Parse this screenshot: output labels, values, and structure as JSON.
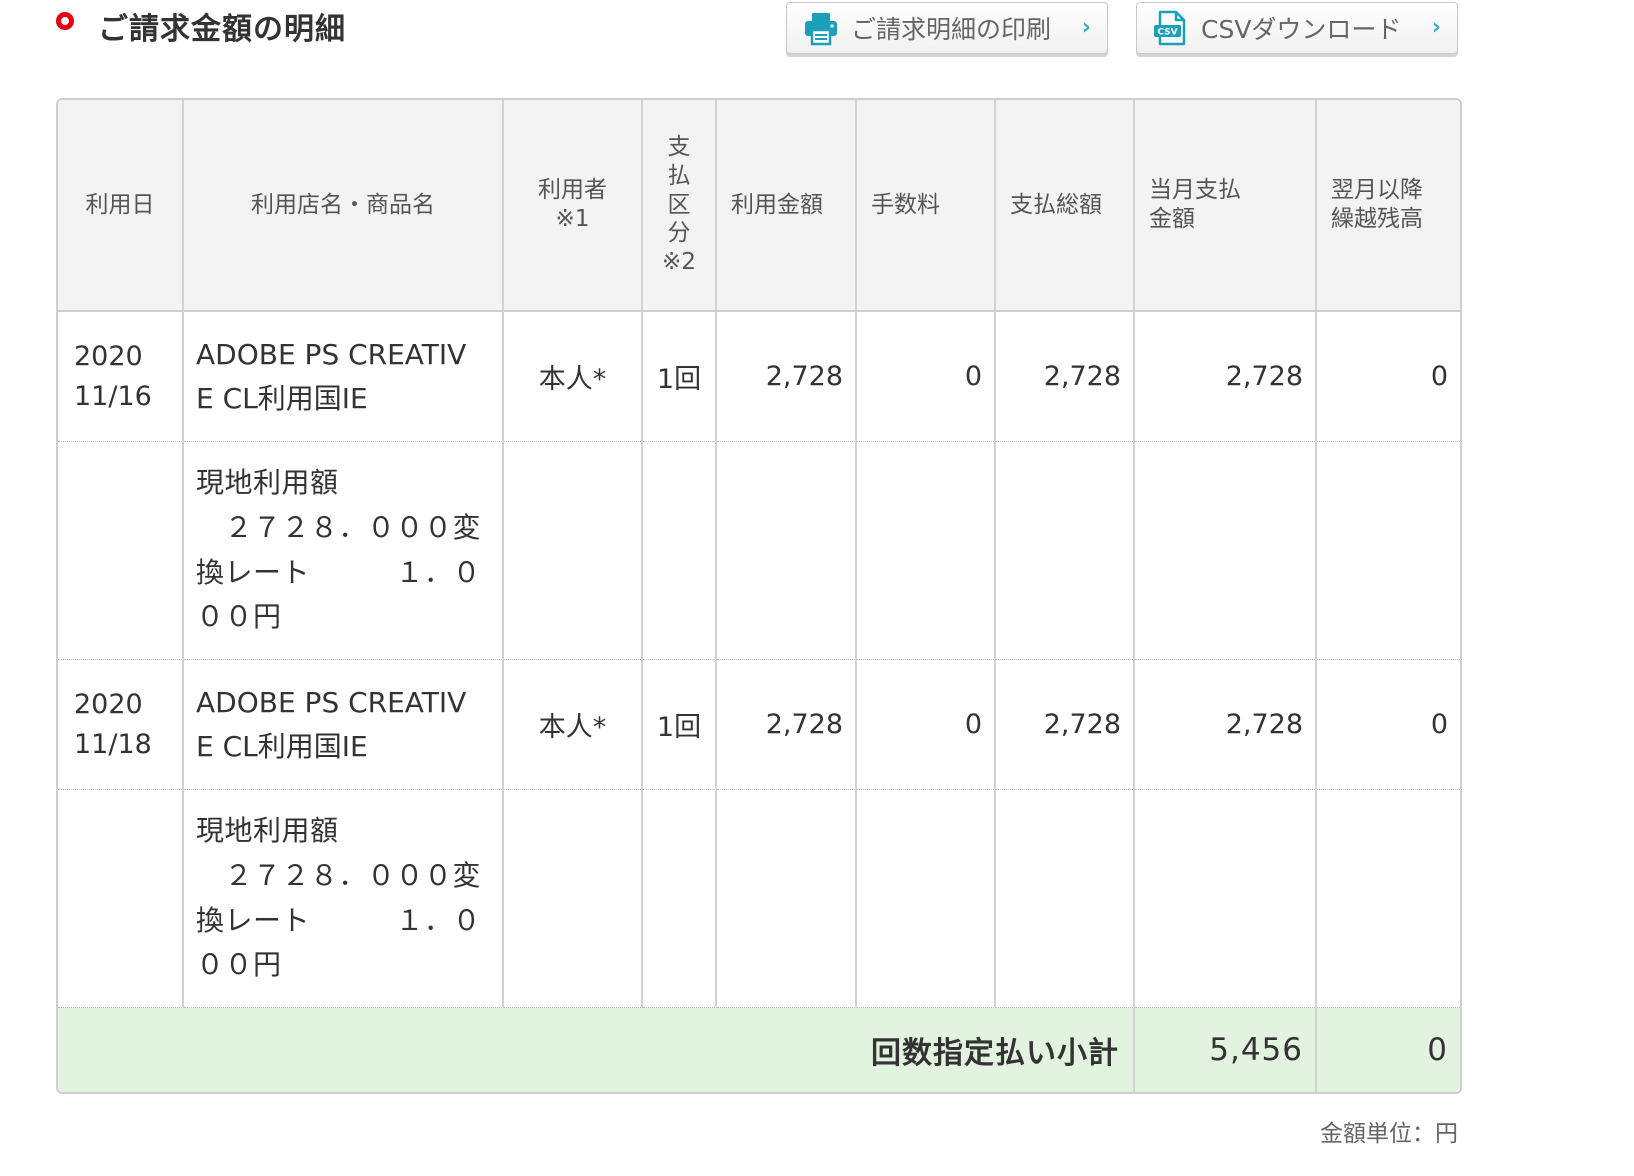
{
  "header": {
    "title": "ご請求金額の明細",
    "buttons": {
      "print_label": "ご請求明細の印刷",
      "csv_label": "CSVダウンロード",
      "chevron": "›",
      "print_icon": "printer-icon",
      "csv_icon": "csv-file-icon"
    }
  },
  "table": {
    "columns": {
      "date": "利用日",
      "shop": "利用店名・商品名",
      "user_line1": "利用者",
      "user_line2": "※1",
      "pay_type_chars": [
        "支",
        "払",
        "区",
        "分",
        "※2"
      ],
      "amount": "利用金額",
      "fee": "手数料",
      "total": "支払総額",
      "current_line1": "当月支払",
      "current_line2": "金額",
      "next_line1": "翌月以降",
      "next_line2": "繰越残高"
    },
    "rows": [
      {
        "date_year": "2020",
        "date_md": "11/16",
        "shop_line1": "ADOBE PS CREATIV",
        "shop_line2": "E CL利用国IE",
        "user": "本人*",
        "pay_type": "1回",
        "amount": "2,728",
        "fee": "0",
        "total": "2,728",
        "current": "2,728",
        "next": "0",
        "note_lines": [
          "現地利用額",
          "　２７２８．０００変",
          "換レート　　　１．０",
          "００円"
        ]
      },
      {
        "date_year": "2020",
        "date_md": "11/18",
        "shop_line1": "ADOBE PS CREATIV",
        "shop_line2": "E CL利用国IE",
        "user": "本人*",
        "pay_type": "1回",
        "amount": "2,728",
        "fee": "0",
        "total": "2,728",
        "current": "2,728",
        "next": "0",
        "note_lines": [
          "現地利用額",
          "　２７２８．０００変",
          "換レート　　　１．０",
          "００円"
        ]
      }
    ],
    "subtotal": {
      "label": "回数指定払い小計",
      "current": "5,456",
      "next": "0"
    }
  },
  "footer": {
    "unit_note": "金額単位：円"
  },
  "colors": {
    "accent_red": "#e60012",
    "accent_teal": "#1aa0b8",
    "subtotal_bg": "#e2f3df",
    "header_bg": "#f3f3f3"
  }
}
